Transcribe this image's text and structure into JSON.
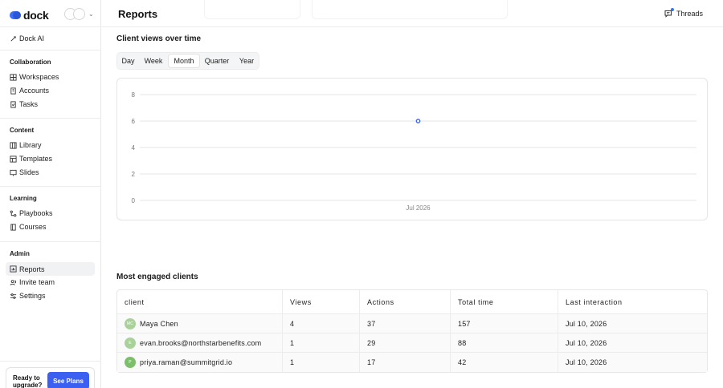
{
  "brand": {
    "name": "dock"
  },
  "sidebar": {
    "top_item": {
      "label": "Dock AI",
      "icon": "sparkle-icon"
    },
    "sections": [
      {
        "title": "Collaboration",
        "items": [
          {
            "label": "Workspaces",
            "icon": "grid-icon"
          },
          {
            "label": "Accounts",
            "icon": "building-icon"
          },
          {
            "label": "Tasks",
            "icon": "checkbox-icon"
          }
        ]
      },
      {
        "title": "Content",
        "items": [
          {
            "label": "Library",
            "icon": "library-icon"
          },
          {
            "label": "Templates",
            "icon": "template-icon"
          },
          {
            "label": "Slides",
            "icon": "slides-icon"
          }
        ]
      },
      {
        "title": "Learning",
        "items": [
          {
            "label": "Playbooks",
            "icon": "playbook-icon"
          },
          {
            "label": "Courses",
            "icon": "book-icon"
          }
        ]
      },
      {
        "title": "Admin",
        "items": [
          {
            "label": "Reports",
            "icon": "chart-icon",
            "active": true
          },
          {
            "label": "Invite team",
            "icon": "users-icon"
          },
          {
            "label": "Settings",
            "icon": "sliders-icon"
          }
        ]
      }
    ],
    "upgrade": {
      "text": "Ready to upgrade?",
      "button": "See Plans"
    }
  },
  "header": {
    "title": "Reports",
    "threads_label": "Threads"
  },
  "views_section": {
    "title": "Client views over time",
    "tabs": [
      "Day",
      "Week",
      "Month",
      "Quarter",
      "Year"
    ],
    "selected_tab": "Month"
  },
  "chart_data": {
    "type": "line",
    "x": [
      "Jul 2026"
    ],
    "series": [
      {
        "values": [
          6
        ]
      }
    ],
    "yticks": [
      0,
      2,
      4,
      6,
      8
    ],
    "ylim": [
      0,
      8
    ],
    "title": "",
    "xlabel": "",
    "ylabel": "",
    "grid": true,
    "colors": {
      "point": "#3b5ff0",
      "grid": "#e6e6e6"
    }
  },
  "clients_section": {
    "title": "Most engaged clients",
    "columns": [
      "client",
      "Views",
      "Actions",
      "Total time",
      "Last interaction"
    ],
    "rows": [
      {
        "initials": "MC",
        "name": "Maya Chen",
        "views": "4",
        "actions": "37",
        "total_time": "157",
        "last": "Jul 10, 2026"
      },
      {
        "initials": "E",
        "name": "evan.brooks@northstarbenefits.com",
        "views": "1",
        "actions": "29",
        "total_time": "88",
        "last": "Jul 10, 2026"
      },
      {
        "initials": "P",
        "name": "priya.raman@summitgrid.io",
        "views": "1",
        "actions": "17",
        "total_time": "42",
        "last": "Jul 10, 2026"
      }
    ]
  }
}
